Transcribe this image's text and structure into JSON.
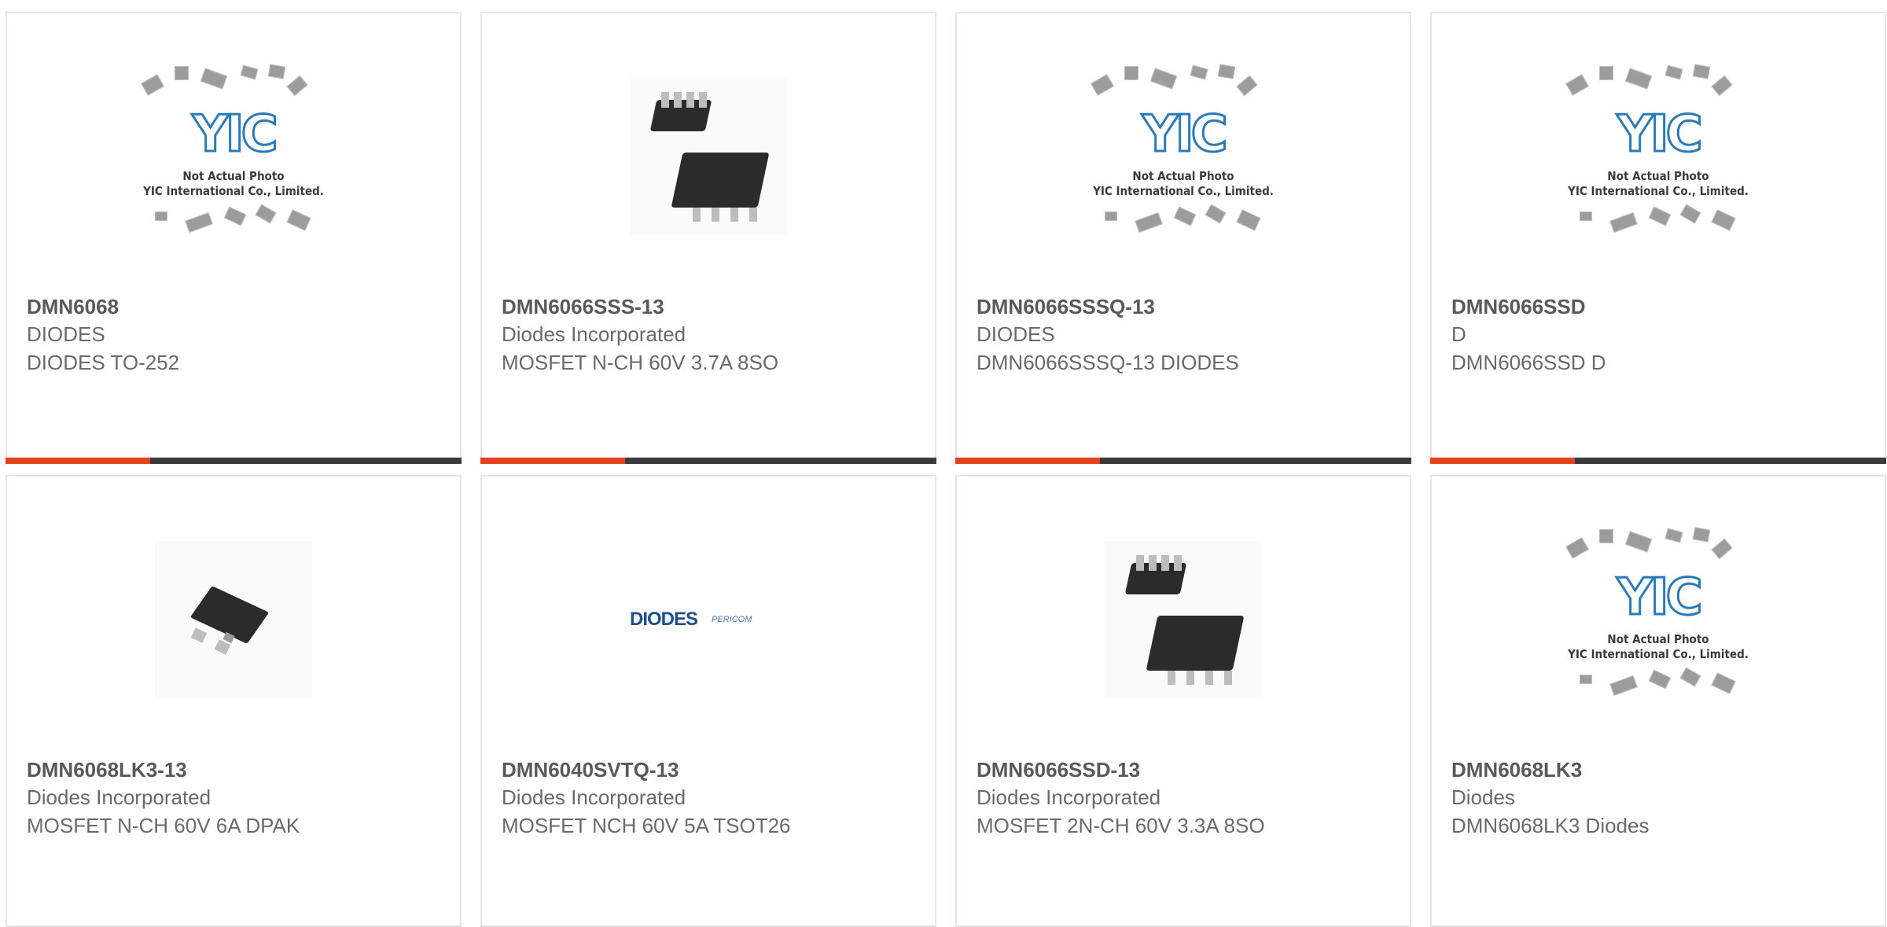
{
  "products": [
    {
      "part": "DMN6068",
      "manufacturer": "DIODES",
      "description": "DIODES TO-252",
      "image": "placeholder"
    },
    {
      "part": "DMN6066SSS-13",
      "manufacturer": "Diodes Incorporated",
      "description": "MOSFET N-CH 60V 3.7A 8SO",
      "image": "soic8"
    },
    {
      "part": "DMN6066SSSQ-13",
      "manufacturer": "DIODES",
      "description": "DMN6066SSSQ-13 DIODES",
      "image": "placeholder"
    },
    {
      "part": "DMN6066SSD",
      "manufacturer": "D",
      "description": "DMN6066SSD D",
      "image": "placeholder"
    },
    {
      "part": "DMN6068LK3-13",
      "manufacturer": "Diodes Incorporated",
      "description": "MOSFET N-CH 60V 6A DPAK",
      "image": "dpak"
    },
    {
      "part": "DMN6040SVTQ-13",
      "manufacturer": "Diodes Incorporated",
      "description": "MOSFET NCH 60V 5A TSOT26",
      "image": "diodes-logo"
    },
    {
      "part": "DMN6066SSD-13",
      "manufacturer": "Diodes Incorporated",
      "description": "MOSFET 2N-CH 60V 3.3A 8SO",
      "image": "soic8"
    },
    {
      "part": "DMN6068LK3",
      "manufacturer": "Diodes",
      "description": "DMN6068LK3 Diodes",
      "image": "placeholder"
    }
  ],
  "placeholder_image": {
    "logo": "YIC",
    "caption_line1": "Not Actual Photo",
    "caption_line2": "YIC International Co., Limited."
  },
  "diodes_logo": {
    "brand": "DIODES",
    "sub": "PERICOM"
  },
  "colors": {
    "accent": "#e2421e",
    "bar": "#3a3a3a",
    "border": "#e6e6e6"
  }
}
